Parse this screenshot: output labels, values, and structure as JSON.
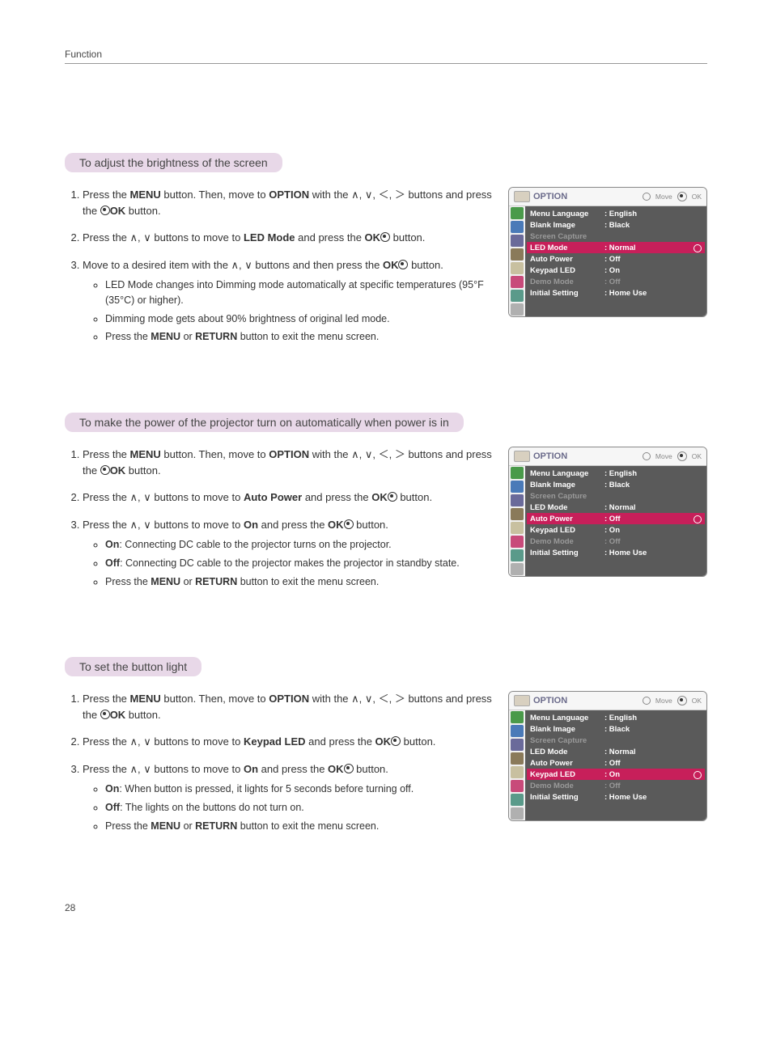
{
  "page": {
    "header_label": "Function",
    "page_number": "28"
  },
  "glyphs": {
    "up": "∧",
    "down": "∨",
    "left": "＜",
    "right": "＞"
  },
  "osd_common": {
    "title": "OPTION",
    "move": "Move",
    "ok": "OK"
  },
  "sections": [
    {
      "title": "To adjust the brightness of the screen",
      "steps": [
        {
          "prefix": "Press the ",
          "b1": "MENU",
          "mid1": " button. Then, move to ",
          "b2": "OPTION",
          "mid2": " with the ∧, ∨, ＜, ＞ buttons and press the ",
          "okbtn": true,
          "b3": "OK",
          "suffix": " button."
        },
        {
          "prefix": "Press the ∧, ∨ buttons to move to ",
          "b1": "LED Mode",
          "mid1": " and press the ",
          "okbtn": true,
          "b2": "OK",
          "suffix": " button."
        },
        {
          "prefix": "Move to a desired item with the ∧, ∨ buttons and then press the ",
          "okbtn": true,
          "b1": "OK",
          "suffix": " button."
        }
      ],
      "bullets": [
        "LED Mode changes into Dimming mode automatically at specific temperatures (95°F (35°C) or higher).",
        "Dimming mode gets about 90% brightness of original led mode.",
        "Press the MENU or RETURN button to exit the menu screen."
      ],
      "bullet_bold_words": {
        "2": [
          "MENU",
          "RETURN"
        ]
      },
      "highlight": "LED Mode",
      "rows": [
        {
          "label": "Menu Language",
          "value": ": English"
        },
        {
          "label": "Blank Image",
          "value": ": Black"
        },
        {
          "label": "Screen Capture",
          "value": "",
          "dim": true
        },
        {
          "label": "LED Mode",
          "value": ": Normal",
          "hl": true
        },
        {
          "label": "Auto Power",
          "value": ": Off"
        },
        {
          "label": "Keypad LED",
          "value": ": On"
        },
        {
          "label": "Demo Mode",
          "value": ": Off",
          "dim": true
        },
        {
          "label": "Initial Setting",
          "value": ": Home Use"
        }
      ]
    },
    {
      "title": "To make the power of the projector turn on automatically when power is in",
      "steps": [
        {
          "prefix": "Press the ",
          "b1": "MENU",
          "mid1": " button. Then, move to ",
          "b2": "OPTION",
          "mid2": " with the ∧, ∨, ＜, ＞ buttons and press the ",
          "okbtn": true,
          "b3": "OK",
          "suffix": " button."
        },
        {
          "prefix": "Press the ∧, ∨ buttons to move to ",
          "b1": "Auto Power",
          "mid1": " and press the ",
          "okbtn": true,
          "b2": "OK",
          "suffix": " button."
        },
        {
          "prefix": "Press the ∧, ∨ buttons to move to ",
          "b1": "On",
          "mid1": " and press the ",
          "okbtn": true,
          "b2": "OK",
          "suffix": " button."
        }
      ],
      "bullets": [
        "On: Connecting DC cable to the projector turns on the projector.",
        "Off: Connecting DC cable to the projector makes the projector in standby state.",
        "Press the MENU or RETURN button to exit the menu screen."
      ],
      "bullet_bold_words": {
        "0": [
          "On"
        ],
        "1": [
          "Off"
        ],
        "2": [
          "MENU",
          "RETURN"
        ]
      },
      "highlight": "Auto Power",
      "rows": [
        {
          "label": "Menu Language",
          "value": ": English"
        },
        {
          "label": "Blank Image",
          "value": ": Black"
        },
        {
          "label": "Screen Capture",
          "value": "",
          "dim": true
        },
        {
          "label": "LED Mode",
          "value": ": Normal"
        },
        {
          "label": "Auto Power",
          "value": ": Off",
          "hl": true
        },
        {
          "label": "Keypad LED",
          "value": ": On"
        },
        {
          "label": "Demo Mode",
          "value": ": Off",
          "dim": true
        },
        {
          "label": "Initial Setting",
          "value": ": Home Use"
        }
      ]
    },
    {
      "title": "To set the button light",
      "steps": [
        {
          "prefix": "Press the ",
          "b1": "MENU",
          "mid1": " button. Then, move to ",
          "b2": "OPTION",
          "mid2": " with the ∧, ∨, ＜, ＞ buttons and press the ",
          "okbtn": true,
          "b3": "OK",
          "suffix": " button."
        },
        {
          "prefix": "Press the ∧, ∨  buttons to move to ",
          "b1": "Keypad LED",
          "mid1": " and press the ",
          "okbtn": true,
          "b2": "OK",
          "suffix": " button."
        },
        {
          "prefix": "Press the ∧, ∨ buttons to move to ",
          "b1": "On",
          "mid1": " and press the ",
          "okbtn": true,
          "b2": "OK",
          "suffix": " button."
        }
      ],
      "bullets": [
        "On: When button is pressed, it lights for 5 seconds before turning off.",
        "Off: The lights on the buttons do not turn on.",
        "Press the MENU or RETURN button to exit the menu screen."
      ],
      "bullet_bold_words": {
        "0": [
          "On"
        ],
        "1": [
          "Off"
        ],
        "2": [
          "MENU",
          "RETURN"
        ]
      },
      "highlight": "Keypad LED",
      "rows": [
        {
          "label": "Menu Language",
          "value": ": English"
        },
        {
          "label": "Blank Image",
          "value": ": Black"
        },
        {
          "label": "Screen Capture",
          "value": "",
          "dim": true
        },
        {
          "label": "LED Mode",
          "value": ": Normal"
        },
        {
          "label": "Auto Power",
          "value": ": Off"
        },
        {
          "label": "Keypad LED",
          "value": ": On",
          "hl": true
        },
        {
          "label": "Demo Mode",
          "value": ": Off",
          "dim": true
        },
        {
          "label": "Initial Setting",
          "value": ": Home Use"
        }
      ]
    }
  ]
}
